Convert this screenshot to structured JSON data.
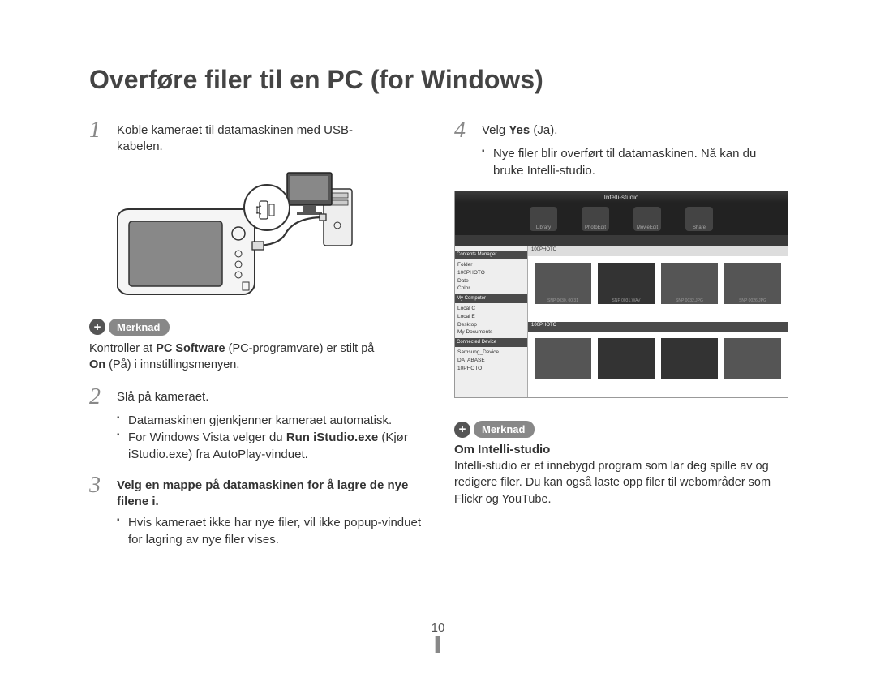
{
  "title": "Overføre filer til en PC (for Windows)",
  "step1": {
    "num": "1",
    "text_a": "Koble kameraet til datamaskinen med USB-",
    "text_b": "kabelen."
  },
  "note1": {
    "label": "Merknad",
    "text_a": "Kontroller at ",
    "bold_a": "PC Software",
    "text_b": " (PC-programvare) er stilt på ",
    "bold_b": "On",
    "text_c": " (På) i innstillingsmenyen."
  },
  "step2": {
    "num": "2",
    "text": "Slå på kameraet.",
    "bullet1": "Datamaskinen gjenkjenner kameraet automatisk.",
    "bullet2_a": "For Windows Vista velger du ",
    "bullet2_bold": "Run iStudio.exe",
    "bullet2_b": " (Kjør iStudio.exe) fra AutoPlay-vinduet."
  },
  "step3": {
    "num": "3",
    "text_a": "Velg en mappe på datamaskinen for å lagre de nye filene i.",
    "bullet1": "Hvis kameraet ikke har nye filer, vil ikke popup-vinduet for lagring av nye filer vises."
  },
  "step4": {
    "num": "4",
    "text_a": "Velg ",
    "bold": "Yes",
    "text_b": " (Ja).",
    "bullet1": "Nye filer blir overført til datamaskinen. Nå kan du bruke Intelli-studio."
  },
  "note2": {
    "label": "Merknad",
    "heading": "Om Intelli-studio",
    "body": "Intelli-studio er et innebygd program som lar deg spille av og redigere filer. Du kan også laste opp filer til webområder som Flickr og YouTube."
  },
  "screenshot": {
    "title": "Intelli-studio",
    "tabs": {
      "a": "Library",
      "b": "PhotoEdit",
      "c": "MovieEdit",
      "d": "Share"
    },
    "tree_hdr1": "Contents Manager",
    "tree_items1": [
      "Folder",
      "100PHOTO",
      "Date",
      "Color"
    ],
    "tree_hdr2": "My Computer",
    "tree_items2": [
      "Local C",
      "Local E",
      "Desktop",
      "My Documents"
    ],
    "tree_hdr3": "Connected Device",
    "tree_items3": [
      "Samsung_Device",
      "DATABASE",
      "10PHOTO"
    ],
    "crumb1": "100PHOTO",
    "crumb2": "100PHOTO",
    "thumb_labels": [
      "SNP 0030. 00:31",
      "SNP 0031.WAV",
      "SNP 0032.JPG",
      "SNP 0026.JPG"
    ]
  },
  "page_number": "10"
}
